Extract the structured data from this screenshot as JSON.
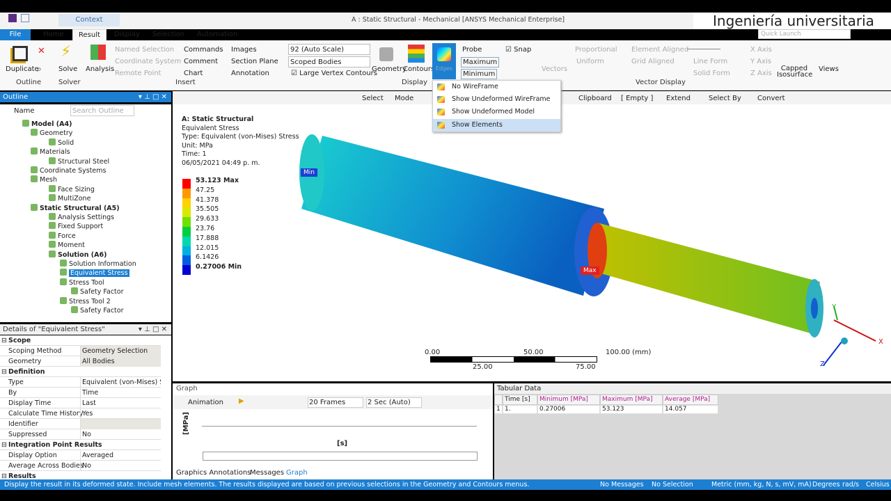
{
  "window": {
    "title": "A : Static Structural - Mechanical [ANSYS Mechanical Enterprise]",
    "context_tab": "Context",
    "watermark": "Ingeniería universitaria",
    "quick_launch_placeholder": "Quick Launch"
  },
  "tabs": [
    "File",
    "Home",
    "Result",
    "Display",
    "Selection",
    "Automation"
  ],
  "ribbon": {
    "outline": {
      "duplicate": "Duplicate",
      "group": "Outline"
    },
    "solve": {
      "solve": "Solve",
      "group": "Solver"
    },
    "insert": {
      "analysis": "Analysis",
      "named_selection": "Named Selection",
      "coordinate_system": "Coordinate System",
      "remote_point": "Remote Point",
      "commands": "Commands",
      "comment": "Comment",
      "chart": "Chart",
      "images": "Images",
      "section_plane": "Section Plane",
      "annotation": "Annotation",
      "group": "Insert"
    },
    "display": {
      "scale": "92 (Auto Scale)",
      "bodies": "Scoped Bodies",
      "large_vertex": "Large Vertex Contours",
      "geometry": "Geometry",
      "contours": "Contours",
      "edges": "Edges",
      "probe": "Probe",
      "maximum": "Maximum",
      "minimum": "Minimum",
      "snap": "Snap",
      "group": "Display"
    },
    "vectors": {
      "vectors": "Vectors",
      "proportional": "Proportional",
      "uniform": "Uniform",
      "element_aligned": "Element Aligned",
      "grid_aligned": "Grid Aligned",
      "line_form": "Line Form",
      "solid_form": "Solid Form",
      "x_axis": "X Axis",
      "y_axis": "Y Axis",
      "z_axis": "Z Axis",
      "group": "Vector Display"
    },
    "capped": "Capped Isosurface",
    "views": "Views"
  },
  "edges_menu": [
    "No WireFrame",
    "Show Undeformed WireFrame",
    "Show Undeformed Model",
    "Show Elements"
  ],
  "toolbar": {
    "select": "Select",
    "mode": "Mode",
    "clipboard": "Clipboard",
    "empty": "[ Empty ]",
    "extend": "Extend",
    "select_by": "Select By",
    "convert": "Convert"
  },
  "outline": {
    "title": "Outline",
    "name_label": "Name",
    "search_placeholder": "Search Outline",
    "items": [
      {
        "label": "Model (A4)",
        "bold": true
      },
      {
        "label": "Geometry"
      },
      {
        "label": "Solid"
      },
      {
        "label": "Materials"
      },
      {
        "label": "Structural Steel"
      },
      {
        "label": "Coordinate Systems"
      },
      {
        "label": "Mesh"
      },
      {
        "label": "Face Sizing"
      },
      {
        "label": "MultiZone"
      },
      {
        "label": "Static Structural (A5)",
        "bold": true
      },
      {
        "label": "Analysis Settings"
      },
      {
        "label": "Fixed Support"
      },
      {
        "label": "Force"
      },
      {
        "label": "Moment"
      },
      {
        "label": "Solution (A6)",
        "bold": true
      },
      {
        "label": "Solution Information"
      },
      {
        "label": "Equivalent Stress",
        "selected": true
      },
      {
        "label": "Stress Tool"
      },
      {
        "label": "Safety Factor"
      },
      {
        "label": "Stress Tool 2"
      },
      {
        "label": "Safety Factor"
      }
    ]
  },
  "details": {
    "title": "Details of \"Equivalent Stress\"",
    "rows": [
      {
        "k": "Scope",
        "section": true
      },
      {
        "k": "Scoping Method",
        "v": "Geometry Selection"
      },
      {
        "k": "Geometry",
        "v": "All Bodies"
      },
      {
        "k": "Definition",
        "section": true
      },
      {
        "k": "Type",
        "v": "Equivalent (von-Mises) St..."
      },
      {
        "k": "By",
        "v": "Time"
      },
      {
        "k": "Display Time",
        "v": "Last"
      },
      {
        "k": "Calculate Time History",
        "v": "Yes"
      },
      {
        "k": "Identifier",
        "v": ""
      },
      {
        "k": "Suppressed",
        "v": "No"
      },
      {
        "k": "Integration Point Results",
        "section": true
      },
      {
        "k": "Display Option",
        "v": "Averaged"
      },
      {
        "k": "Average Across Bodies",
        "v": "No"
      },
      {
        "k": "Results",
        "section": true
      }
    ]
  },
  "viewport": {
    "info": [
      "A: Static Structural",
      "Equivalent Stress",
      "Type: Equivalent (von-Mises) Stress",
      "Unit: MPa",
      "Time: 1",
      "06/05/2021 04:49 p. m."
    ],
    "legend": [
      "53.123 Max",
      "47.25",
      "41.378",
      "35.505",
      "29.633",
      "23.76",
      "17.888",
      "12.015",
      "6.1426",
      "0.27006 Min"
    ],
    "legend_colors": [
      "#ff0000",
      "#ff9900",
      "#ffd200",
      "#d8e800",
      "#6fe000",
      "#00d040",
      "#00d8b0",
      "#00b0e0",
      "#0060e0",
      "#0000d0"
    ],
    "min_label": "Min",
    "max_label": "Max",
    "scale": {
      "top": [
        "0.00",
        "50.00",
        "100.00 (mm)"
      ],
      "bottom": [
        "25.00",
        "75.00"
      ]
    },
    "axes": {
      "x": "X",
      "y": "Y",
      "z": "Z"
    }
  },
  "graph": {
    "title": "Graph",
    "animation": "Animation",
    "frames": "20 Frames",
    "duration": "2 Sec (Auto)",
    "y_unit": "[MPa]",
    "x_unit": "[s]",
    "tabs": [
      "Graphics Annotations",
      "Messages",
      "Graph"
    ]
  },
  "tabular": {
    "title": "Tabular Data",
    "headers": [
      "Time [s]",
      "Minimum [MPa]",
      "Maximum [MPa]",
      "Average [MPa]"
    ],
    "rows": [
      [
        "1",
        "1.",
        "0.27006",
        "53.123",
        "14.057"
      ]
    ]
  },
  "status": {
    "hint": "Display the result in its deformed state. Include mesh elements. The results displayed are based on previous selections in the Geometry and Contours menus.",
    "messages": "No Messages",
    "selection": "No Selection",
    "units": "Metric (mm, kg, N, s, mV, mA)",
    "angle": "Degrees",
    "rot": "rad/s",
    "temp": "Celsius"
  }
}
